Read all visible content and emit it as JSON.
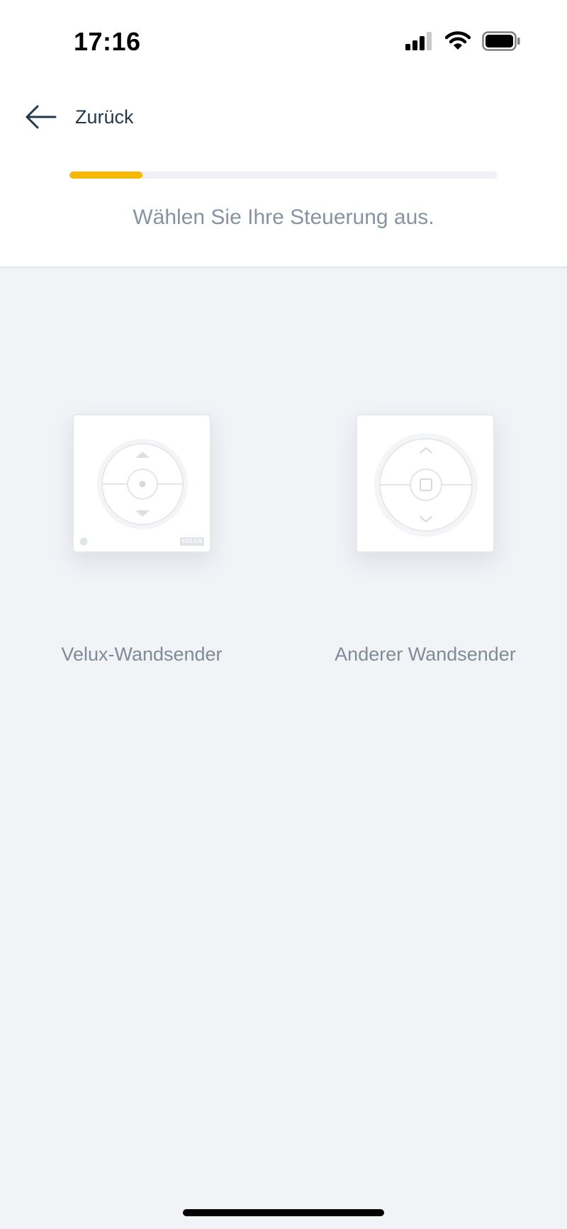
{
  "status_bar": {
    "time": "17:16"
  },
  "nav": {
    "back_label": "Zurück"
  },
  "progress": {
    "value": 0.17,
    "color": "#f5b800"
  },
  "instruction": "Wählen Sie Ihre Steuerung aus.",
  "options": [
    {
      "label": "Velux-Wandsender",
      "brand_mark": "VELUX",
      "icon": "velux-wall-switch-icon"
    },
    {
      "label": "Anderer Wandsender",
      "icon": "generic-wall-switch-icon"
    }
  ]
}
